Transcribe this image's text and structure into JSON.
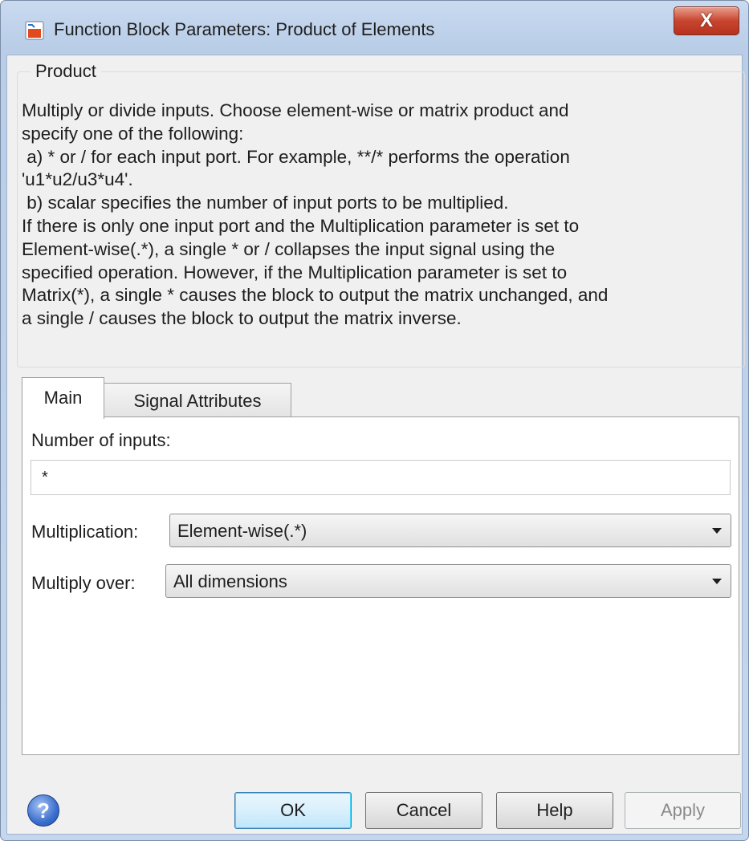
{
  "window": {
    "title": "Function Block Parameters: Product of Elements",
    "close_label": "X"
  },
  "group": {
    "legend": "Product",
    "description_lines": [
      "Multiply or divide inputs.  Choose element-wise or matrix product and",
      "specify one of the following:",
      " a) * or / for each input port. For example, **/* performs the operation",
      "'u1*u2/u3*u4'.",
      " b) scalar specifies the number of input ports to be multiplied.",
      "If there is only one input port and the Multiplication parameter is set to",
      "Element-wise(.*), a single * or / collapses the input signal using the",
      "specified operation. However, if the Multiplication parameter is set to",
      "Matrix(*), a single * causes the block to output the matrix unchanged, and",
      "a single / causes the block to output the matrix inverse."
    ]
  },
  "tabs": [
    {
      "label": "Main",
      "selected": true
    },
    {
      "label": "Signal Attributes",
      "selected": false
    }
  ],
  "main": {
    "num_inputs_label": "Number of inputs:",
    "num_inputs_value": "*",
    "multiplication_label": "Multiplication:",
    "multiplication_value": "Element-wise(.*)",
    "multiply_over_label": "Multiply over:",
    "multiply_over_value": "All dimensions"
  },
  "buttons": {
    "help_icon": "?",
    "ok": "OK",
    "cancel": "Cancel",
    "help": "Help",
    "apply": "Apply"
  },
  "icons": {
    "app": "simulink-block-icon",
    "help": "question-circle-icon",
    "dropdown": "chevron-down-icon"
  },
  "colors": {
    "titlebar": "#c9daf0",
    "close_button": "#c7452f",
    "ok_highlight": "#3c7fb1",
    "dialog_bg": "#f0f0f0"
  }
}
